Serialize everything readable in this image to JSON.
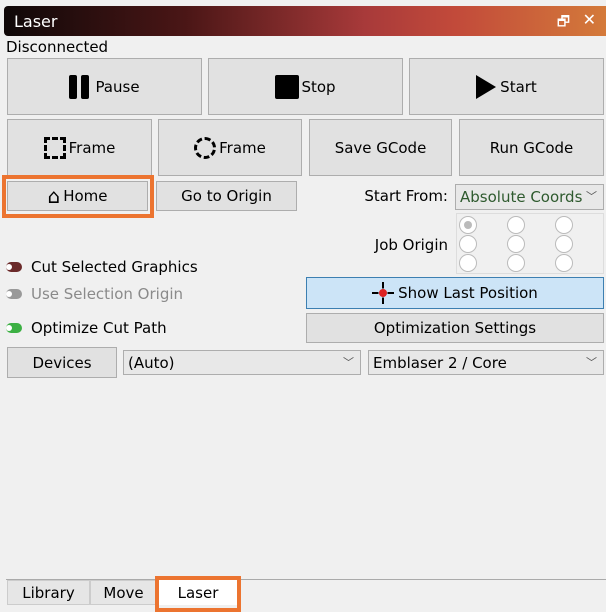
{
  "window": {
    "title": "Laser",
    "restore_icon": "restore-icon",
    "close_icon": "close-icon"
  },
  "status": "Disconnected",
  "buttons": {
    "pause": "Pause",
    "stop": "Stop",
    "start": "Start",
    "frame_rect": "Frame",
    "frame_circle": "Frame",
    "save_gcode": "Save GCode",
    "run_gcode": "Run GCode",
    "home": "Home",
    "go_to_origin": "Go to Origin",
    "show_last_position": "Show Last Position",
    "optimization_settings": "Optimization Settings",
    "devices": "Devices"
  },
  "start_from": {
    "label": "Start From:",
    "value": "Absolute Coords"
  },
  "job_origin": {
    "label": "Job Origin",
    "selected": "top-left"
  },
  "toggles": [
    {
      "label": "Cut Selected Graphics",
      "state": "on",
      "color": "#6b2a2a"
    },
    {
      "label": "Use Selection Origin",
      "state": "disabled",
      "color": "#999999"
    },
    {
      "label": "Optimize Cut Path",
      "state": "on",
      "color": "#3cb043"
    }
  ],
  "port": {
    "value": "(Auto)"
  },
  "device": {
    "value": "Emblaser 2 / Core"
  },
  "tabs": [
    {
      "label": "Library"
    },
    {
      "label": "Move"
    },
    {
      "label": "Laser",
      "active": true
    }
  ],
  "highlight_color": "#ec7430"
}
